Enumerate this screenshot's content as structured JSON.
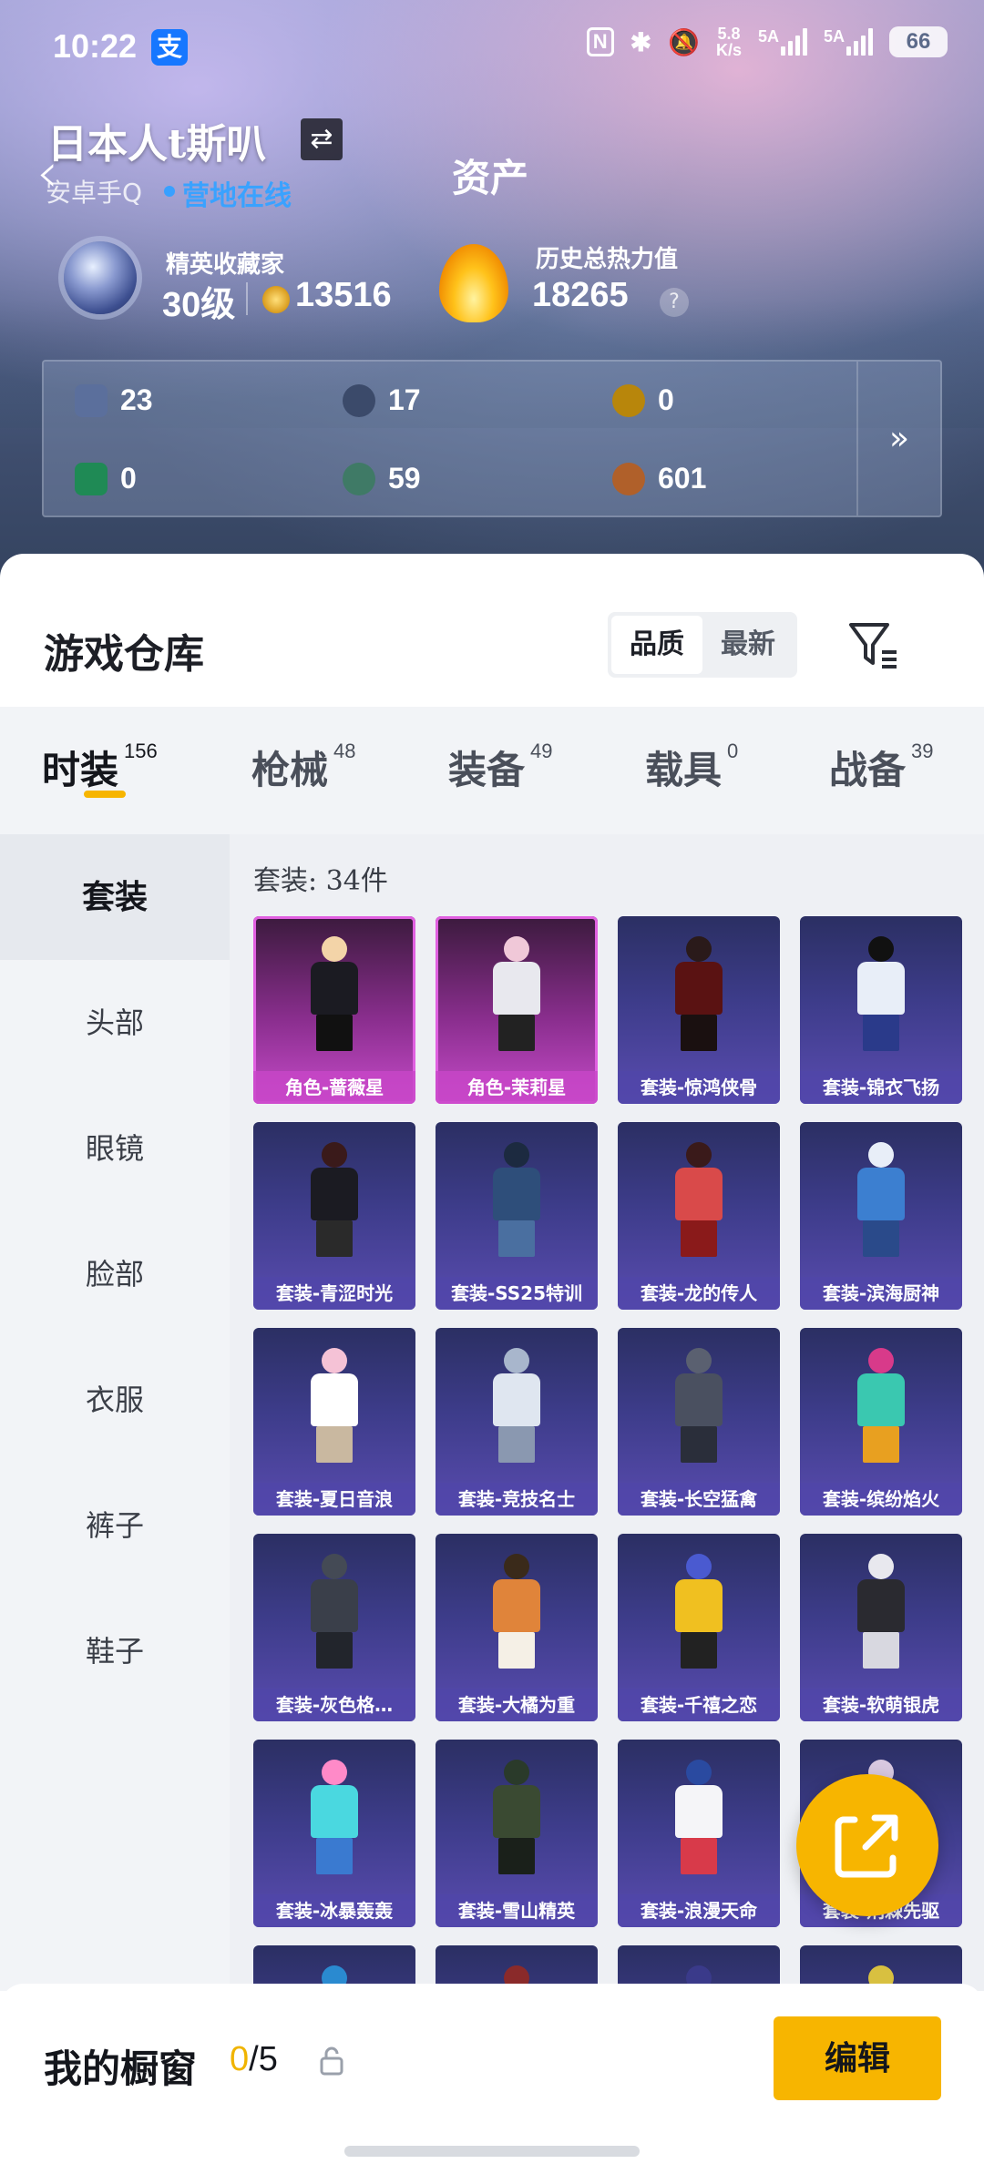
{
  "status_bar": {
    "time": "10:22",
    "pay_badge": "支",
    "nfc": "N",
    "net_speed_top": "5.8",
    "net_speed_bottom": "K/s",
    "signal1_label": "5A",
    "signal2_label": "5A",
    "battery": "66"
  },
  "header": {
    "player_name": "日本人t斯叭",
    "swap_icon": "⇄",
    "platform": "安卓手Q",
    "online_status": "营地在线",
    "page_title": "资产",
    "rank_title": "精英收藏家",
    "rank_level": "30级",
    "rank_points": "13516",
    "heat_title": "历史总热力值",
    "heat_value": "18265",
    "help": "?"
  },
  "assets": {
    "items": [
      {
        "name": "card-asset",
        "value": "23",
        "color": "#5b6f9c"
      },
      {
        "name": "silver-coin",
        "value": "17",
        "color": "#3b4a6a"
      },
      {
        "name": "gold-token",
        "value": "0",
        "color": "#b8860b"
      },
      {
        "name": "green-ticket",
        "value": "0",
        "color": "#1f8a55"
      },
      {
        "name": "green-gem",
        "value": "59",
        "color": "#3f7a66"
      },
      {
        "name": "bronze-token",
        "value": "601",
        "color": "#b0602a"
      }
    ],
    "more": "»"
  },
  "warehouse": {
    "title": "游戏仓库",
    "sort_quality": "品质",
    "sort_latest": "最新"
  },
  "tabs": [
    {
      "label": "时装",
      "count": "156"
    },
    {
      "label": "枪械",
      "count": "48"
    },
    {
      "label": "装备",
      "count": "49"
    },
    {
      "label": "载具",
      "count": "0"
    },
    {
      "label": "战备",
      "count": "39"
    }
  ],
  "side_nav": [
    "套装",
    "头部",
    "眼镜",
    "脸部",
    "衣服",
    "裤子",
    "鞋子"
  ],
  "grid": {
    "heading": "套装: 34件",
    "cards": [
      {
        "label": "角色-蔷薇星",
        "rarity": "pink",
        "c1": "#f3d4a8",
        "c2": "#1b1b22",
        "c3": "#111"
      },
      {
        "label": "角色-茉莉星",
        "rarity": "pink",
        "c1": "#f0c8d8",
        "c2": "#e8e8ee",
        "c3": "#222"
      },
      {
        "label": "套装-惊鸿侠骨",
        "rarity": "purple",
        "c1": "#2a1a1a",
        "c2": "#5a1212",
        "c3": "#1a1010"
      },
      {
        "label": "套装-锦衣飞扬",
        "rarity": "purple",
        "c1": "#111",
        "c2": "#e8eef8",
        "c3": "#2a3a8a"
      },
      {
        "label": "套装-青涩时光",
        "rarity": "purple",
        "c1": "#3a1a1a",
        "c2": "#1b1b22",
        "c3": "#2a2a2a"
      },
      {
        "label": "套装-SS25特训",
        "rarity": "purple",
        "c1": "#1c2a40",
        "c2": "#2e4e7a",
        "c3": "#4a6fa0"
      },
      {
        "label": "套装-龙的传人",
        "rarity": "purple",
        "c1": "#3a1a1a",
        "c2": "#d94a4a",
        "c3": "#8a1a1a"
      },
      {
        "label": "套装-滨海厨神",
        "rarity": "purple",
        "c1": "#e8eef8",
        "c2": "#3c7fd0",
        "c3": "#2a4a8a"
      },
      {
        "label": "套装-夏日音浪",
        "rarity": "purple",
        "c1": "#f5c2d6",
        "c2": "#ffffff",
        "c3": "#c9b8a0"
      },
      {
        "label": "套装-竞技名士",
        "rarity": "purple",
        "c1": "#a8b6cc",
        "c2": "#dfe6f0",
        "c3": "#8a98b0"
      },
      {
        "label": "套装-长空猛禽",
        "rarity": "purple",
        "c1": "#5a6070",
        "c2": "#4a5060",
        "c3": "#2a2e3a"
      },
      {
        "label": "套装-缤纷焰火",
        "rarity": "purple",
        "c1": "#d83a8a",
        "c2": "#3ac8b0",
        "c3": "#e8a020"
      },
      {
        "label": "套装-灰色格…",
        "rarity": "purple",
        "c1": "#444a55",
        "c2": "#3a3f4a",
        "c3": "#22252c"
      },
      {
        "label": "套装-大橘为重",
        "rarity": "purple",
        "c1": "#3a2a1a",
        "c2": "#e0843a",
        "c3": "#f5f0e6"
      },
      {
        "label": "套装-千禧之恋",
        "rarity": "purple",
        "c1": "#4a5ad0",
        "c2": "#f0c020",
        "c3": "#222"
      },
      {
        "label": "套装-软萌银虎",
        "rarity": "purple",
        "c1": "#e8e8ee",
        "c2": "#2a2a30",
        "c3": "#d8d8e0"
      },
      {
        "label": "套装-冰暴轰轰",
        "rarity": "purple",
        "c1": "#ff8ac8",
        "c2": "#4ad8e0",
        "c3": "#3a7ad0"
      },
      {
        "label": "套装-雪山精英",
        "rarity": "purple",
        "c1": "#2a3a2a",
        "c2": "#3a4a32",
        "c3": "#1a201a"
      },
      {
        "label": "套装-浪漫天命",
        "rarity": "purple",
        "c1": "#2a4aa0",
        "c2": "#f5f5f8",
        "c3": "#d83a4a"
      },
      {
        "label": "套装-荆棘先驱",
        "rarity": "purple",
        "c1": "#d8c8e0",
        "c2": "#6a5aa0",
        "c3": "#2a2a3a"
      },
      {
        "label": "",
        "rarity": "purple",
        "c1": "#2a8ad0",
        "c2": "#3a3a8a",
        "c3": "#2a2a6a"
      },
      {
        "label": "",
        "rarity": "purple",
        "c1": "#8a2a2a",
        "c2": "#3a3a8a",
        "c3": "#2a2a6a"
      },
      {
        "label": "",
        "rarity": "purple",
        "c1": "#3a3a8a",
        "c2": "#3a3a8a",
        "c3": "#2a2a6a"
      },
      {
        "label": "",
        "rarity": "purple",
        "c1": "#d8c040",
        "c2": "#3a3a8a",
        "c3": "#2a2a6a"
      }
    ]
  },
  "showcase": {
    "label": "我的橱窗",
    "used": "0",
    "total": "/5",
    "edit": "编辑"
  }
}
